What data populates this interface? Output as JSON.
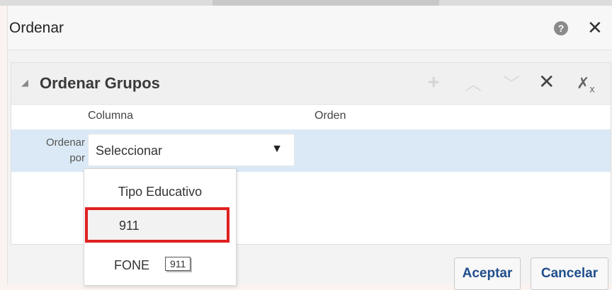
{
  "dialog": {
    "title": "Ordenar",
    "help_icon": "help-icon",
    "close_icon": "close-icon"
  },
  "panel": {
    "title": "Ordenar Grupos",
    "toolbar_icons": [
      "add-icon",
      "move-up-icon",
      "move-down-icon",
      "delete-icon",
      "delete-all-icon"
    ]
  },
  "table": {
    "columns": [
      "Columna",
      "Orden"
    ],
    "row_label_line1": "Ordenar",
    "row_label_line2": "por",
    "select_value": "Seleccionar"
  },
  "dropdown": {
    "options": [
      "Tipo Educativo",
      "911",
      "FONE"
    ],
    "highlighted": "911",
    "tooltip": "911"
  },
  "buttons": {
    "ok": "Aceptar",
    "cancel": "Cancelar"
  },
  "colors": {
    "highlight_border": "#e02020",
    "row_selected": "#dbe9f6",
    "button_text": "#1f4e8c"
  }
}
